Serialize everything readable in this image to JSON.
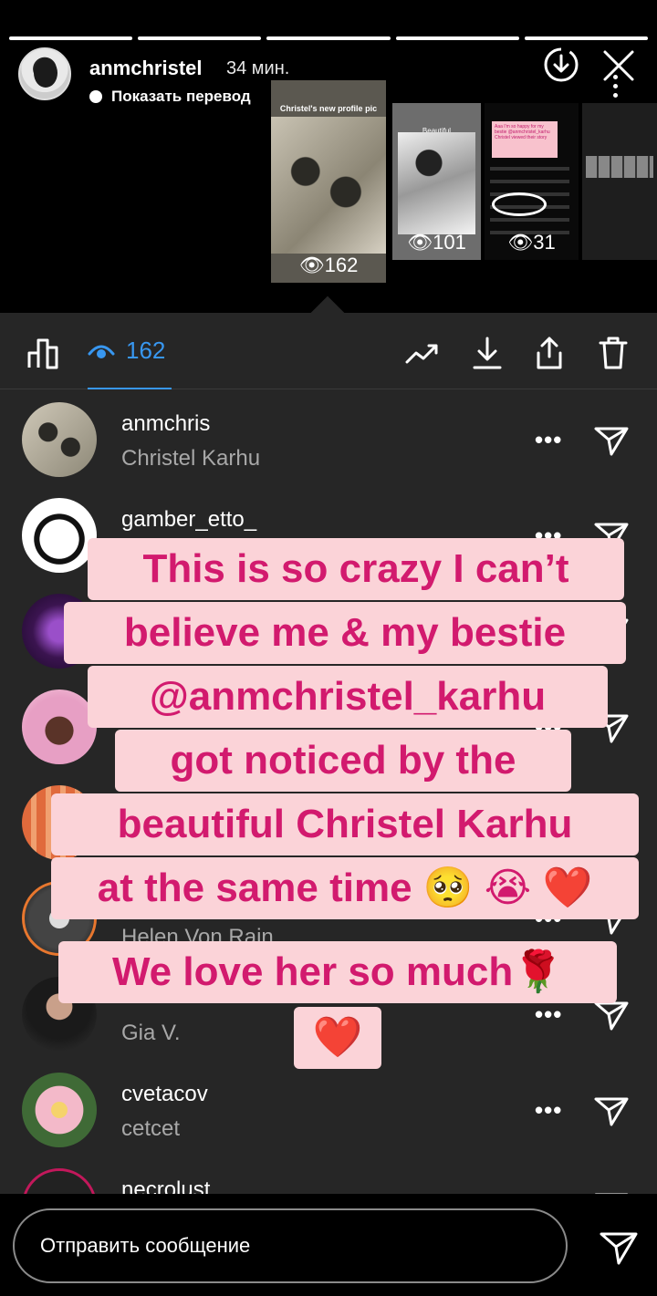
{
  "header": {
    "username": "anmchristel",
    "time": "34 мин.",
    "translate_label": "Показать перевод"
  },
  "thumbnails": [
    {
      "caption": "Christel's new profile pic",
      "views": "162"
    },
    {
      "caption": "Beautiful",
      "views": "101"
    },
    {
      "caption": "Aaa I'm so happy for my bestie @anmchristel_karhu Christel viewed their story",
      "views": "31"
    },
    {
      "caption": "",
      "views": ""
    }
  ],
  "toolbar": {
    "views_count": "162"
  },
  "viewers": [
    {
      "username": "anmchris",
      "full_name": "Christel Karhu",
      "more": "•••"
    },
    {
      "username": "gamber_etto_",
      "full_name": "",
      "more": "•••"
    },
    {
      "username": "",
      "full_name": "",
      "more": "•••"
    },
    {
      "username": "",
      "full_name": "",
      "more": "•••"
    },
    {
      "username": "",
      "full_name": "",
      "more": "•••"
    },
    {
      "username": "",
      "full_name": "Helen Von Rain",
      "more": "•••"
    },
    {
      "username": "",
      "full_name": "Gia V.",
      "more": "•••"
    },
    {
      "username": "cvetacov",
      "full_name": "cetcet",
      "more": "•••"
    },
    {
      "username": "necrolust",
      "full_name": "",
      "more": ""
    }
  ],
  "overlay": {
    "lines": [
      "This is so crazy I can’t",
      "believe me & my bestie",
      "@anmchristel_karhu",
      "got noticed by the",
      "beautiful Christel Karhu",
      "at the same time 🥺 😭 ❤️",
      "We love her so much🌹",
      "❤️"
    ]
  },
  "message": {
    "placeholder": "Отправить сообщение"
  },
  "colors": {
    "accent": "#3897f0",
    "overlay_bg": "#fbd3d8",
    "overlay_text": "#d21a6e",
    "panel_bg": "#262626"
  }
}
